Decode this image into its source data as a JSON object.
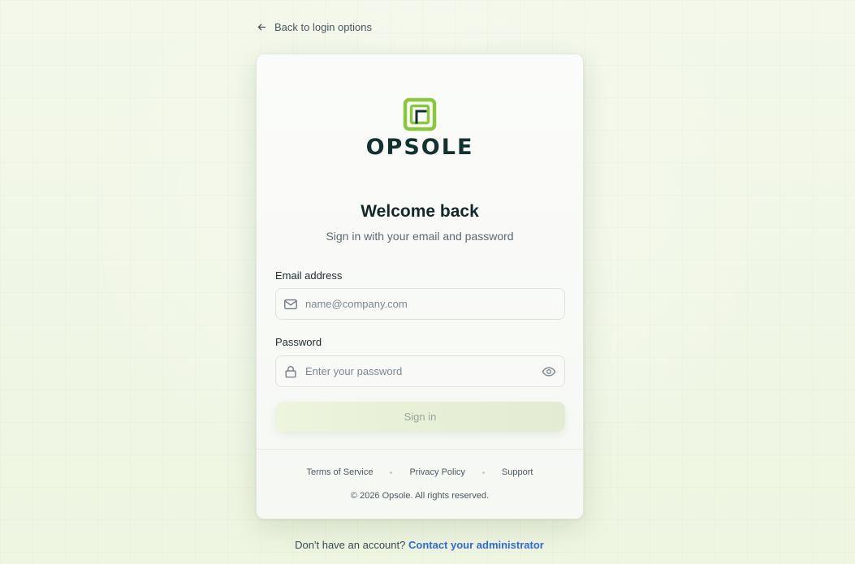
{
  "nav": {
    "back_label": "Back to login options"
  },
  "brand": {
    "name": "OPSOLE",
    "accent_color": "#8cc63f",
    "text_color": "#13312f"
  },
  "form": {
    "heading": "Welcome back",
    "subheading": "Sign in with your email and password",
    "email": {
      "label": "Email address",
      "placeholder": "name@company.com",
      "value": ""
    },
    "password": {
      "label": "Password",
      "placeholder": "Enter your password",
      "value": ""
    },
    "submit_label": "Sign in"
  },
  "footer": {
    "links": [
      "Terms of Service",
      "Privacy Policy",
      "Support"
    ],
    "copyright": "© 2026 Opsole. All rights reserved."
  },
  "signup": {
    "prompt": "Don't have an account?",
    "link_label": "Contact your administrator",
    "link_color": "#2f6ad6"
  },
  "icons": {
    "back": "arrow-left-icon",
    "email": "mail-icon",
    "password": "lock-icon",
    "toggle_visibility": "eye-icon"
  }
}
